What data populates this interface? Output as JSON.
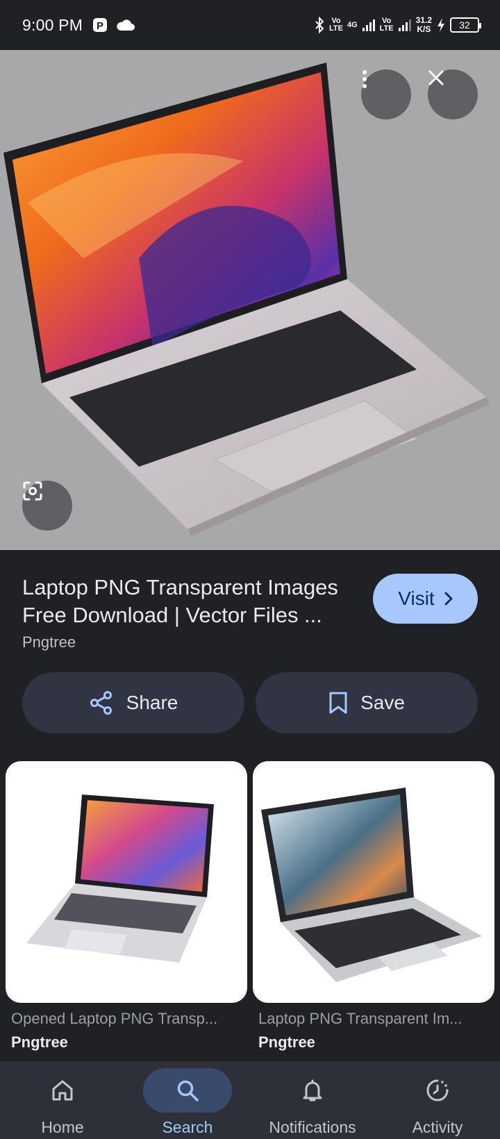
{
  "status_bar": {
    "time": "9:00 PM",
    "net1": "Vo\nLTE",
    "net2": "4G",
    "net3": "Vo\nLTE",
    "speed_value": "31.2",
    "speed_unit": "K/S",
    "battery": "32"
  },
  "viewer": {
    "more_icon": "more-vert-icon",
    "close_icon": "close-icon",
    "lens_icon": "lens-icon"
  },
  "result": {
    "title": "Laptop PNG Transparent Images Free Download | Vector Files ...",
    "source": "Pngtree",
    "visit_label": "Visit",
    "share_label": "Share",
    "save_label": "Save"
  },
  "related": [
    {
      "caption": "Opened Laptop PNG Transp...",
      "source": "Pngtree"
    },
    {
      "caption": "Laptop PNG Transparent Im...",
      "source": "Pngtree"
    }
  ],
  "nav": {
    "items": [
      {
        "label": "Home",
        "icon": "home-icon",
        "active": false
      },
      {
        "label": "Search",
        "icon": "search-icon",
        "active": true
      },
      {
        "label": "Notifications",
        "icon": "bell-icon",
        "active": false
      },
      {
        "label": "Activity",
        "icon": "activity-icon",
        "active": false
      }
    ]
  },
  "colors": {
    "background": "#202124",
    "accent": "#a8c7fa",
    "chip": "#303443",
    "nav_bg": "#2d3039"
  }
}
